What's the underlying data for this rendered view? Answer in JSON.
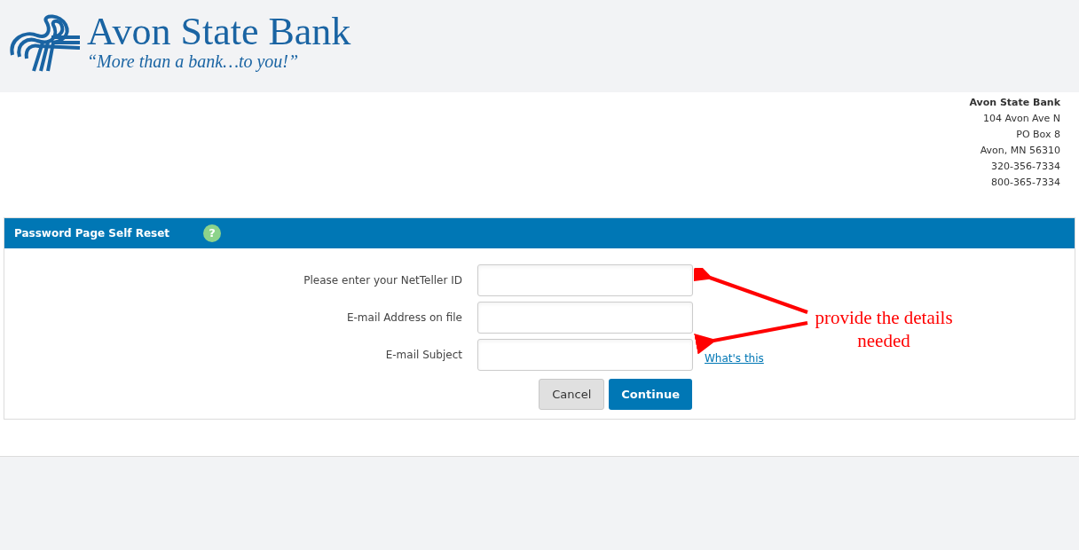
{
  "logo": {
    "name": "Avon State Bank",
    "tagline": "“More than a bank…to you!”"
  },
  "address": {
    "title": "Avon State Bank",
    "lines": [
      "104 Avon Ave N",
      "PO Box 8",
      "Avon, MN 56310",
      "320-356-7334",
      "800-365-7334"
    ]
  },
  "panel": {
    "title": "Password Page Self Reset",
    "help": "?",
    "fields": [
      {
        "label": "Please enter your NetTeller ID"
      },
      {
        "label": "E-mail Address on file"
      },
      {
        "label": "E-mail Subject",
        "link": "What's this"
      }
    ],
    "buttons": [
      {
        "label": "Cancel",
        "kind": "secondary"
      },
      {
        "label": "Continue",
        "kind": "primary"
      }
    ]
  },
  "annotation": {
    "lines": [
      "provide the details",
      "needed"
    ]
  }
}
